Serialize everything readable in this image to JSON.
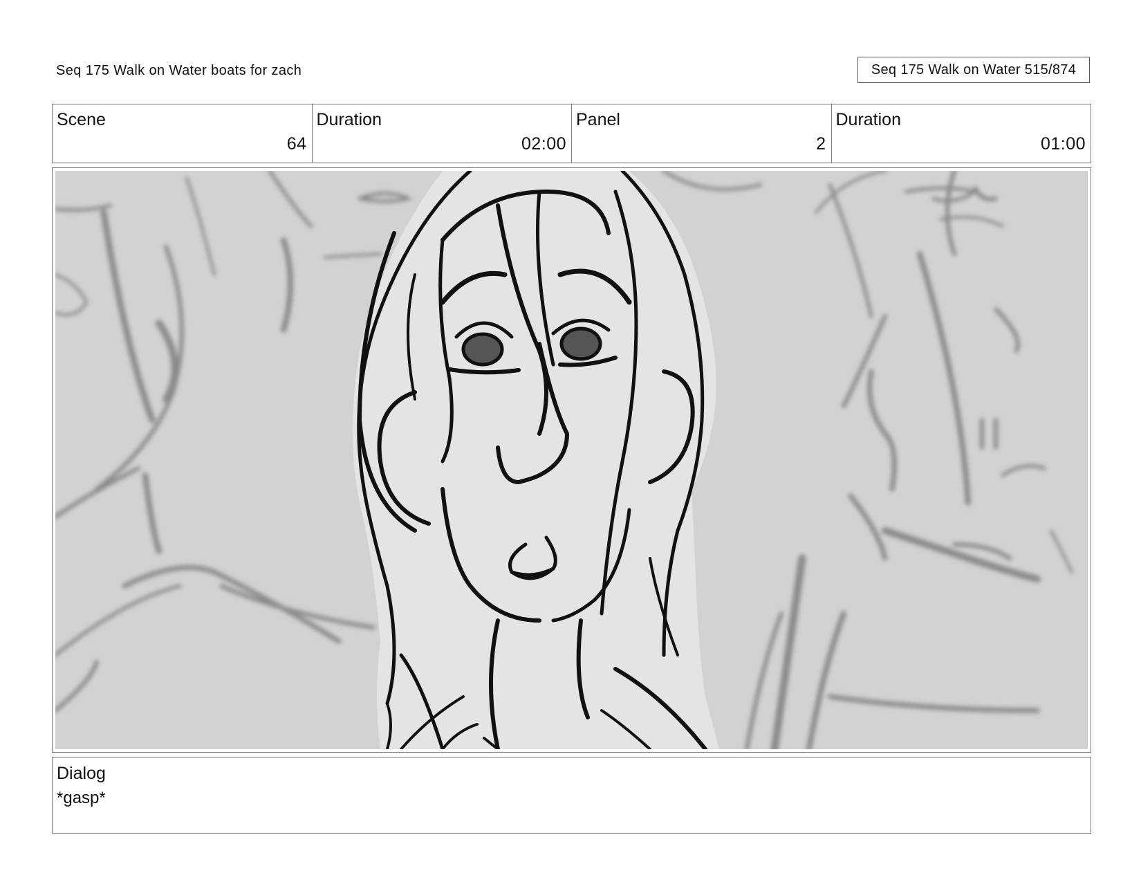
{
  "header": {
    "title": "Seq 175 Walk on Water  boats for zach",
    "page_label": "Seq 175 Walk on Water 515/874"
  },
  "meta": {
    "scene_label": "Scene",
    "scene_value": "64",
    "scene_duration_label": "Duration",
    "scene_duration_value": "02:00",
    "panel_label": "Panel",
    "panel_value": "2",
    "panel_duration_label": "Duration",
    "panel_duration_value": "01:00"
  },
  "panel": {
    "image_name": "storyboard-sketch-gasping-character-closeup",
    "background_color": "#d2d2d2",
    "figure_fill": "#e4e4e4",
    "line_color": "#111111",
    "blur_line_color": "#8a8a8a"
  },
  "dialog": {
    "label": "Dialog",
    "text": "*gasp*"
  }
}
